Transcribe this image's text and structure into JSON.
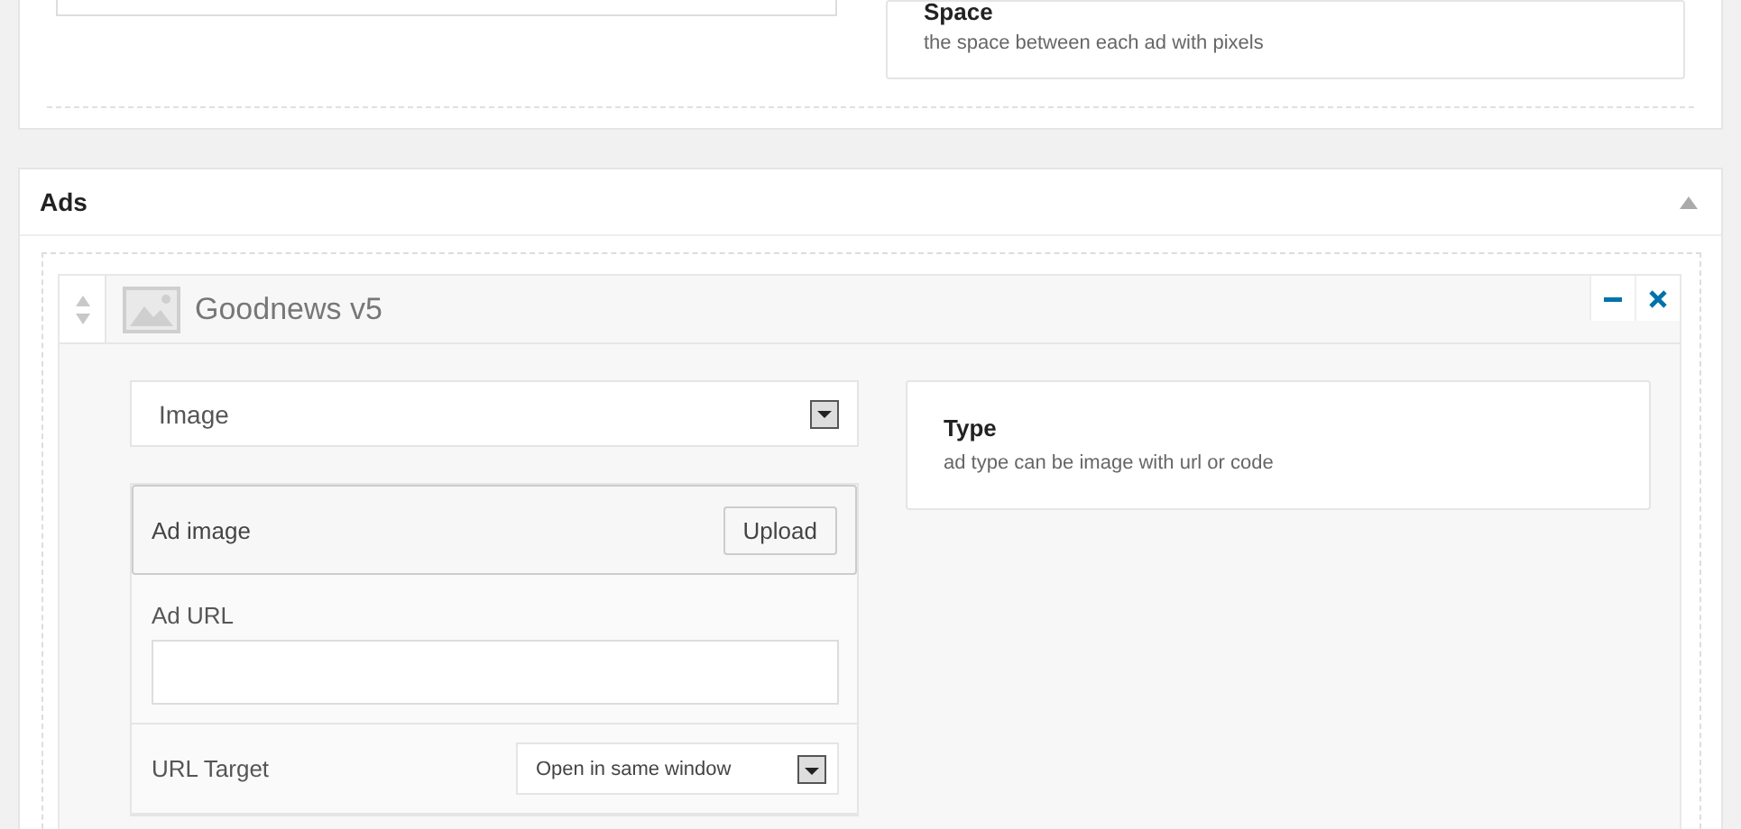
{
  "top_panel": {
    "help": {
      "title": "Space",
      "description": "the space between each ad with pixels"
    }
  },
  "ads_panel": {
    "title": "Ads",
    "expanded": true,
    "item": {
      "title": "Goodnews v5",
      "type_select": {
        "value": "Image"
      },
      "type_help": {
        "title": "Type",
        "description": "ad type can be image with url or code"
      },
      "fields": [
        {
          "kind": "upload",
          "label": "Ad image",
          "button": "Upload"
        },
        {
          "kind": "text",
          "label": "Ad URL"
        },
        {
          "kind": "select",
          "label": "URL Target",
          "value": "Open in same window"
        }
      ]
    }
  }
}
